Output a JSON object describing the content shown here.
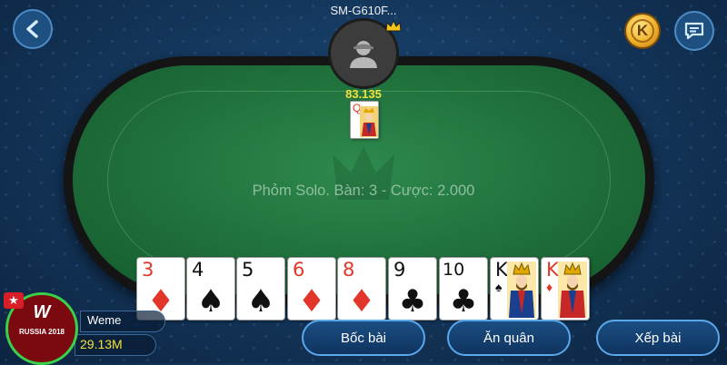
{
  "opponent": {
    "name": "SM-G610F...",
    "chips": "83.135"
  },
  "table": {
    "info": "Phỏm Solo. Bàn: 3 - Cược: 2.000"
  },
  "center_card": {
    "rank": "Q",
    "suit": "♦",
    "color": "red"
  },
  "hand": [
    {
      "rank": "3",
      "suit": "♦",
      "color": "red"
    },
    {
      "rank": "4",
      "suit": "♠",
      "color": "black"
    },
    {
      "rank": "5",
      "suit": "♠",
      "color": "black"
    },
    {
      "rank": "6",
      "suit": "♦",
      "color": "red"
    },
    {
      "rank": "8",
      "suit": "♦",
      "color": "red"
    },
    {
      "rank": "9",
      "suit": "♣",
      "color": "black"
    },
    {
      "rank": "10",
      "suit": "♣",
      "color": "black"
    },
    {
      "rank": "K",
      "suit": "♠",
      "color": "black"
    },
    {
      "rank": "K",
      "suit": "♦",
      "color": "red"
    }
  ],
  "player": {
    "name": "Weme",
    "chips": "29.13M",
    "avatar_text": "RUSSIA 2018",
    "badge_icon": "star-icon"
  },
  "top_bar": {
    "coin_label": "K",
    "back_icon": "back-arrow-icon",
    "chat_icon": "chat-icon"
  },
  "actions": {
    "draw": "Bốc bài",
    "take": "Ăn quân",
    "sort": "Xếp bài"
  },
  "colors": {
    "felt": "#1f6f3b",
    "chips_yellow": "#f3e23a",
    "button_border": "#5aa7ea"
  }
}
